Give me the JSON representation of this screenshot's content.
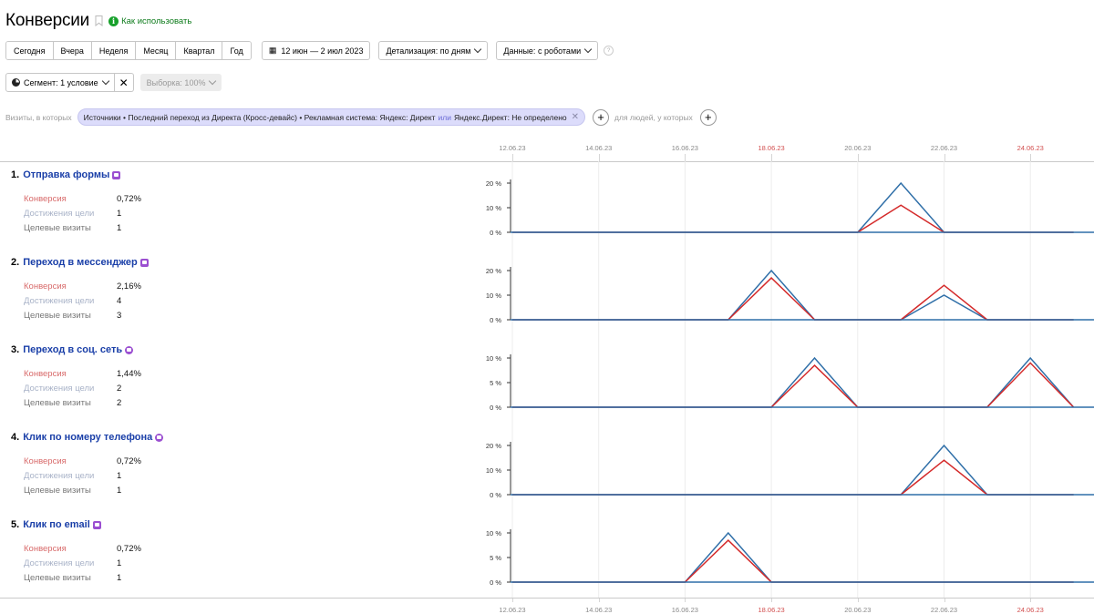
{
  "header": {
    "title": "Конверсии",
    "help_label": "Как использовать",
    "info_glyph": "i"
  },
  "toolbar": {
    "periods": [
      "Сегодня",
      "Вчера",
      "Неделя",
      "Месяц",
      "Квартал",
      "Год"
    ],
    "date_range": "12 июн — 2 июл 2023",
    "detail": "Детализация: по дням",
    "data_mode": "Данные: с роботами",
    "help_glyph": "?"
  },
  "segment": {
    "label": "Сегмент: 1 условие",
    "clear_glyph": "✕",
    "sample": "Выборка: 100%"
  },
  "filter": {
    "prefix": "Визиты, в которых",
    "chip_part1": "Источники • Последний переход из Директа (Кросс-девайс) • Рекламная система: Яндекс: Директ",
    "chip_or": "или",
    "chip_part2": "Яндекс.Директ: Не определено",
    "chip_close_glyph": "✕",
    "add_glyph": "+",
    "people_label": "для людей, у которых"
  },
  "axis": {
    "top_labels": [
      "12.06.23",
      "14.06.23",
      "16.06.23",
      "18.06.23",
      "20.06.23",
      "22.06.23",
      "24.06.23"
    ],
    "bottom_labels": [
      "12.06.23",
      "14.06.23",
      "16.06.23",
      "18.06.23",
      "20.06.23",
      "22.06.23",
      "24.06.23"
    ],
    "weekend_labels": [
      "18.06.23",
      "24.06.23"
    ]
  },
  "metric_labels": {
    "conversion": "Конверсия",
    "reaches": "Достижения цели",
    "visits": "Целевые визиты"
  },
  "goals": [
    {
      "num": "1.",
      "name": "Отправка формы",
      "icon": "form-icon",
      "conversion": "0,72%",
      "reaches": "1",
      "visits": "1"
    },
    {
      "num": "2.",
      "name": "Переход в мессенджер",
      "icon": "messenger-icon",
      "conversion": "2,16%",
      "reaches": "4",
      "visits": "3"
    },
    {
      "num": "3.",
      "name": "Переход в соц. сеть",
      "icon": "social-icon",
      "conversion": "1,44%",
      "reaches": "2",
      "visits": "2"
    },
    {
      "num": "4.",
      "name": "Клик по номеру телефона",
      "icon": "phone-icon",
      "conversion": "0,72%",
      "reaches": "1",
      "visits": "1"
    },
    {
      "num": "5.",
      "name": "Клик по email",
      "icon": "email-icon",
      "conversion": "0,72%",
      "reaches": "1",
      "visits": "1"
    }
  ],
  "colors": {
    "blue_series": "#2f6fa8",
    "red_series": "#d42a2a",
    "goal_title": "#1a3fa8",
    "weekend": "#d24f4f"
  },
  "chart_data": [
    {
      "type": "line",
      "x": [
        "12.06.23",
        "13.06.23",
        "14.06.23",
        "15.06.23",
        "16.06.23",
        "17.06.23",
        "18.06.23",
        "19.06.23",
        "20.06.23",
        "21.06.23",
        "22.06.23",
        "23.06.23",
        "24.06.23",
        "25.06.23"
      ],
      "yticks": [
        "20 %",
        "10 %",
        "0 %"
      ],
      "ylim": [
        0,
        20
      ],
      "series": [
        {
          "color": "#2f6fa8",
          "values": [
            0,
            0,
            0,
            0,
            0,
            0,
            0,
            0,
            0,
            20,
            0,
            0,
            0,
            0
          ]
        },
        {
          "color": "#d42a2a",
          "values": [
            0,
            0,
            0,
            0,
            0,
            0,
            0,
            0,
            0,
            11,
            0,
            0,
            0,
            0
          ]
        }
      ]
    },
    {
      "type": "line",
      "x": [
        "12.06.23",
        "13.06.23",
        "14.06.23",
        "15.06.23",
        "16.06.23",
        "17.06.23",
        "18.06.23",
        "19.06.23",
        "20.06.23",
        "21.06.23",
        "22.06.23",
        "23.06.23",
        "24.06.23",
        "25.06.23"
      ],
      "yticks": [
        "20 %",
        "10 %",
        "0 %"
      ],
      "ylim": [
        0,
        20
      ],
      "series": [
        {
          "color": "#2f6fa8",
          "values": [
            0,
            0,
            0,
            0,
            0,
            0,
            20,
            0,
            0,
            0,
            10,
            0,
            0,
            0
          ]
        },
        {
          "color": "#d42a2a",
          "values": [
            0,
            0,
            0,
            0,
            0,
            0,
            17,
            0,
            0,
            0,
            14,
            0,
            0,
            0
          ]
        }
      ]
    },
    {
      "type": "line",
      "x": [
        "12.06.23",
        "13.06.23",
        "14.06.23",
        "15.06.23",
        "16.06.23",
        "17.06.23",
        "18.06.23",
        "19.06.23",
        "20.06.23",
        "21.06.23",
        "22.06.23",
        "23.06.23",
        "24.06.23",
        "25.06.23"
      ],
      "yticks": [
        "10 %",
        "5 %",
        "0 %"
      ],
      "ylim": [
        0,
        10
      ],
      "series": [
        {
          "color": "#2f6fa8",
          "values": [
            0,
            0,
            0,
            0,
            0,
            0,
            0,
            10,
            0,
            0,
            0,
            0,
            10,
            0
          ]
        },
        {
          "color": "#d42a2a",
          "values": [
            0,
            0,
            0,
            0,
            0,
            0,
            0,
            8.5,
            0,
            0,
            0,
            0,
            9,
            0
          ]
        }
      ]
    },
    {
      "type": "line",
      "x": [
        "12.06.23",
        "13.06.23",
        "14.06.23",
        "15.06.23",
        "16.06.23",
        "17.06.23",
        "18.06.23",
        "19.06.23",
        "20.06.23",
        "21.06.23",
        "22.06.23",
        "23.06.23",
        "24.06.23",
        "25.06.23"
      ],
      "yticks": [
        "20 %",
        "10 %",
        "0 %"
      ],
      "ylim": [
        0,
        20
      ],
      "series": [
        {
          "color": "#2f6fa8",
          "values": [
            0,
            0,
            0,
            0,
            0,
            0,
            0,
            0,
            0,
            0,
            20,
            0,
            0,
            0
          ]
        },
        {
          "color": "#d42a2a",
          "values": [
            0,
            0,
            0,
            0,
            0,
            0,
            0,
            0,
            0,
            0,
            14,
            0,
            0,
            0
          ]
        }
      ]
    },
    {
      "type": "line",
      "x": [
        "12.06.23",
        "13.06.23",
        "14.06.23",
        "15.06.23",
        "16.06.23",
        "17.06.23",
        "18.06.23",
        "19.06.23",
        "20.06.23",
        "21.06.23",
        "22.06.23",
        "23.06.23",
        "24.06.23",
        "25.06.23"
      ],
      "yticks": [
        "10 %",
        "5 %",
        "0 %"
      ],
      "ylim": [
        0,
        10
      ],
      "series": [
        {
          "color": "#2f6fa8",
          "values": [
            0,
            0,
            0,
            0,
            0,
            10,
            0,
            0,
            0,
            0,
            0,
            0,
            0,
            0
          ]
        },
        {
          "color": "#d42a2a",
          "values": [
            0,
            0,
            0,
            0,
            0,
            8.5,
            0,
            0,
            0,
            0,
            0,
            0,
            0,
            0
          ]
        }
      ]
    }
  ]
}
